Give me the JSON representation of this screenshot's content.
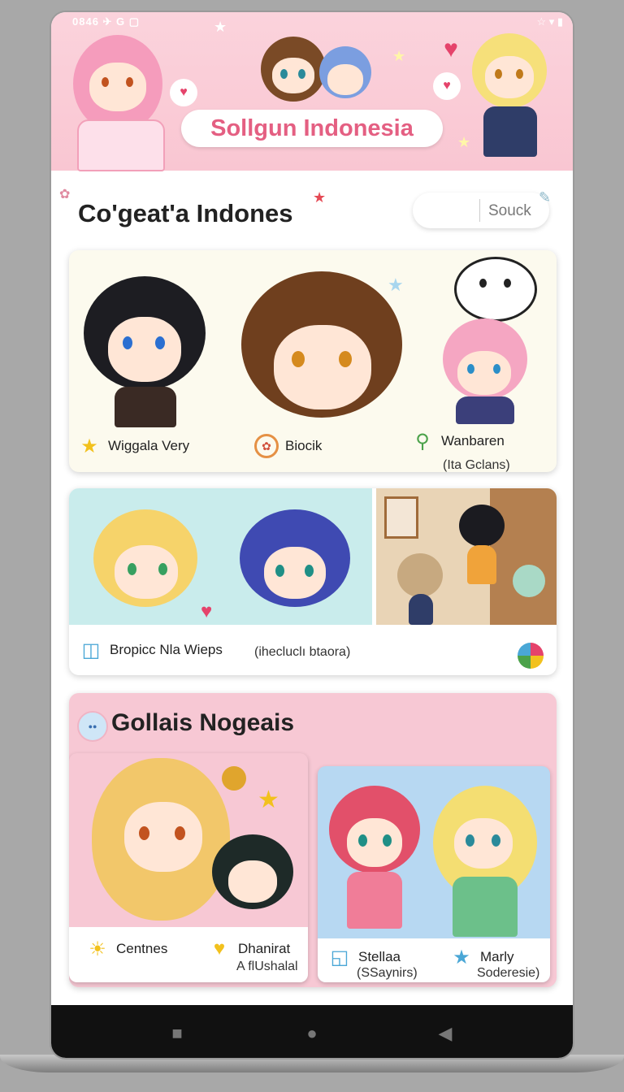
{
  "status_bar": {
    "left": "0846 ✈ G ▢",
    "right": "☆ ▾ ▮"
  },
  "banner": {
    "title": "Sollgun Indonesia"
  },
  "header": {
    "title": "Co'geat'a Indones",
    "search_placeholder": "Souck"
  },
  "card1": {
    "items": [
      {
        "icon": "star-icon",
        "label": "Wiggala Very",
        "sub": ""
      },
      {
        "icon": "badge-icon",
        "label": "Biocik",
        "sub": ""
      },
      {
        "icon": "pin-icon",
        "label": "Wanbaren",
        "sub": "(Ita Gclans)"
      }
    ]
  },
  "card2": {
    "left_label": "Bropicc Nla Wieps",
    "right_label": "(ihecluclı btaora)"
  },
  "section3": {
    "title": "Gollais Nogeais",
    "cards": [
      {
        "a_label": "Centnes",
        "b_label": "Dhanirat",
        "b_sub": "A flUshalal"
      },
      {
        "a_label": "Stellaa",
        "a_sub": "(SSaynirs)",
        "b_label": "Marly",
        "b_sub": "Soderesie)"
      }
    ]
  },
  "nav": {
    "back": "◀",
    "home": "●",
    "recent": "■"
  },
  "colors": {
    "banner": "#f9c6d2",
    "title_pink": "#e45f82",
    "card1_bg": "#fcfaee",
    "card2_bg": "#c9ecec",
    "section3_bg": "#f7c8d4",
    "right_card_bg": "#b7d8f2"
  }
}
